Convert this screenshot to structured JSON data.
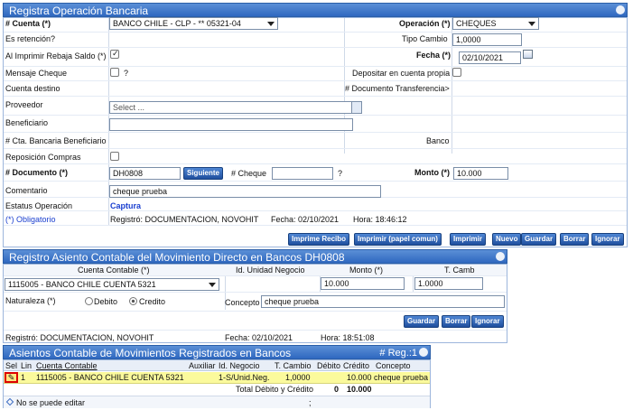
{
  "sec1": {
    "title": "Registra Operación Bancaria",
    "cuenta_label": "# Cuenta (*)",
    "cuenta_value": "BANCO CHILE - CLP - ** 05321-04",
    "operacion_label": "Operación (*)",
    "operacion_value": "CHEQUES",
    "retencion_label": "Es retención?",
    "tipo_cambio_label": "Tipo Cambio",
    "tipo_cambio_value": "1,0000",
    "rebaja_label": "Al Imprimir Rebaja Saldo (*)",
    "fecha_label": "Fecha (*)",
    "fecha_value": "02/10/2021",
    "mensaje_label": "Mensaje Cheque",
    "q1": "?",
    "depositar_label": "Depositar en cuenta propia",
    "cuenta_destino_label": "Cuenta destino",
    "doc_transf_label": "# Documento Transferencia>",
    "proveedor_label": "Proveedor",
    "proveedor_placeholder": "Select ...",
    "beneficiario_label": "Beneficiario",
    "cta_benef_label": "# Cta. Bancaria Beneficiario",
    "banco_label": "Banco",
    "reposicion_label": "Reposición Compras",
    "documento_label": "# Documento (*)",
    "documento_value": "DH0808",
    "siguiente_label": "Siguiente",
    "cheque_label": "# Cheque",
    "q2": "?",
    "monto_label": "Monto (*)",
    "monto_value": "10.000",
    "comentario_label": "Comentario",
    "comentario_value": "cheque prueba",
    "estatus_label": "Estatus Operación",
    "estatus_value": "Captura",
    "obligatorio_label": "(*) Obligatorio",
    "registro_text": "Registró: DOCUMENTACION, NOVOHIT",
    "registro_fecha": "Fecha: 02/10/2021",
    "registro_hora": "Hora:  18:46:12",
    "buttons": [
      "Imprime Recibo",
      "Imprimir (papel comun)",
      "Imprimir",
      "Nuevo",
      "Guardar",
      "Borrar",
      "Ignorar"
    ]
  },
  "sec2": {
    "title": "Registro Asiento Contable del Movimiento Directo en Bancos DH0808",
    "cuenta_contable_header": "Cuenta Contable (*)",
    "id_unidad_header": "Id. Unidad Negocio",
    "monto_header": "Monto (*)",
    "tcamb_header": "T. Camb",
    "cuenta_value": "1115005 - BANCO CHILE CUENTA 5321",
    "monto_value": "10.000",
    "tcamb_value": "1.0000",
    "naturaleza_label": "Naturaleza (*)",
    "debito_label": "Debito",
    "credito_label": "Credito",
    "concepto_label": "Concepto",
    "concepto_value": "cheque prueba",
    "buttons": [
      "Guardar",
      "Borrar",
      "Ignorar"
    ],
    "registro_text": "Registró: DOCUMENTACION, NOVOHIT",
    "registro_fecha": "Fecha: 02/10/2021",
    "registro_hora": "Hora:   18:51:08"
  },
  "sec3": {
    "title": "Asientos Contable de Movimientos Registrados en Bancos",
    "reg_count": "# Reg.:1",
    "headers": [
      "Sel",
      "Lin",
      "Cuenta Contable",
      "Auxiliar",
      "Id. Negocio",
      "T. Cambio",
      "Débito",
      "Crédito",
      "Concepto"
    ],
    "row": [
      "1",
      "1115005 - BANCO CHILE CUENTA 5321",
      "",
      "1-S/Unid.Neg.",
      "1,0000",
      "",
      "10.000",
      "cheque prueba"
    ],
    "total_label": "Total Débito y Crédito",
    "total_debito": "0",
    "total_credito": "10.000",
    "footer_note": "No se puede editar",
    "footer_sep": ";"
  }
}
